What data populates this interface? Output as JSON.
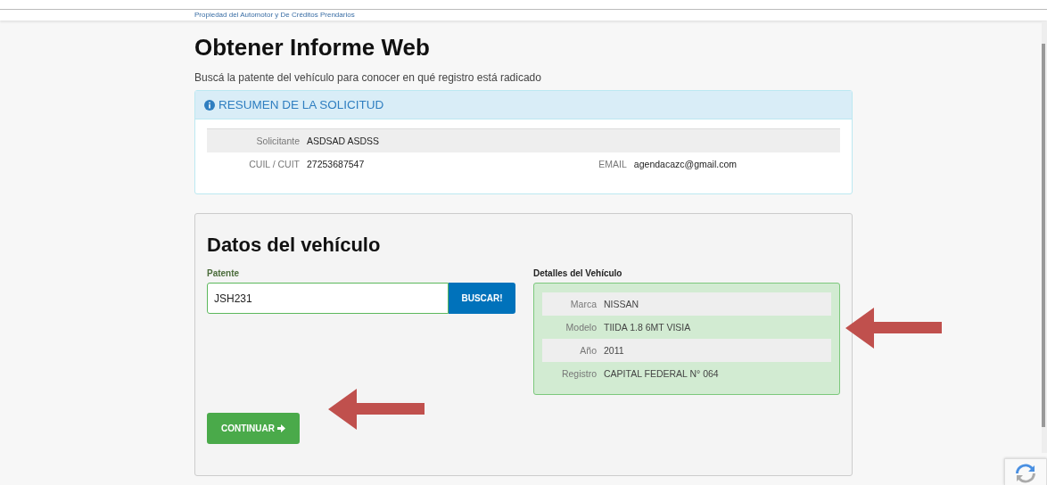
{
  "header": {
    "caption": "Propiedad del Automotor y De Créditos Prendarios"
  },
  "title": "Obtener Informe Web",
  "subtitle": "Buscá la patente del vehículo para conocer en qué registro está radicado",
  "summary": {
    "heading": "RESUMEN DE LA SOLICITUD",
    "rows": [
      {
        "cells": [
          {
            "label": "Solicitante",
            "value": "ASDSAD ASDSS"
          }
        ]
      },
      {
        "cells": [
          {
            "label": "CUIL / CUIT",
            "value": "27253687547"
          },
          {
            "label": "EMAIL",
            "value": "agendacazc@gmail.com"
          }
        ]
      }
    ]
  },
  "vehicle": {
    "heading": "Datos del vehículo",
    "field": {
      "label": "Patente",
      "value": "JSH231"
    },
    "search_button": "BUSCAR!",
    "details": {
      "heading": "Detalles del Vehículo",
      "rows": [
        {
          "label": "Marca",
          "value": "NISSAN"
        },
        {
          "label": "Modelo",
          "value": "TIIDA 1.8 6MT VISIA"
        },
        {
          "label": "Año",
          "value": "2011"
        },
        {
          "label": "Registro",
          "value": "CAPITAL FEDERAL N° 064"
        }
      ]
    },
    "continue_button": "CONTINUAR"
  }
}
